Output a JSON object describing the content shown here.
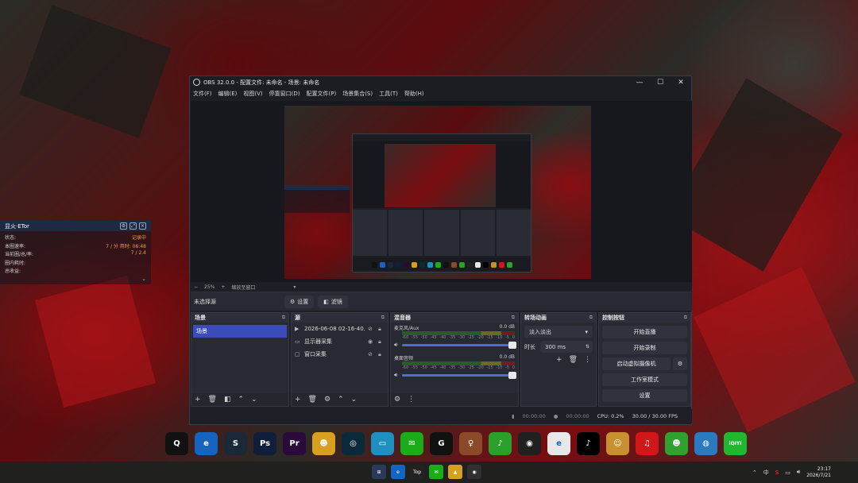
{
  "overlay": {
    "title": "显火·ETor",
    "rows": [
      {
        "label": "状态:",
        "value": "记录中"
      },
      {
        "label": "本圈速率:",
        "value": "7 / 分 用时: 06:48"
      },
      {
        "label": "当前圈/总/率:",
        "value": "7 / 2.4"
      },
      {
        "label": "圈内耗时:",
        "value": ""
      },
      {
        "label": "总收益:",
        "value": ""
      }
    ]
  },
  "obs": {
    "title": "OBS 32.0.0 - 配置文件: 未命名 - 场景: 未命名",
    "window_buttons": [
      "—",
      "☐",
      "✕"
    ],
    "menu": [
      "文件(F)",
      "编辑(E)",
      "视图(V)",
      "停靠窗口(D)",
      "配置文件(P)",
      "场景集合(S)",
      "工具(T)",
      "帮助(H)"
    ],
    "zoom": {
      "minus": "−",
      "value": "25%",
      "plus": "+",
      "mode": "缩放至窗口",
      "caret": "▾"
    },
    "source_bar": {
      "label": "未选择源",
      "settings": "设置",
      "filters": "滤镜"
    },
    "scenes": {
      "title": "场景",
      "items": [
        "场景"
      ]
    },
    "sources": {
      "title": "源",
      "items": [
        {
          "name": "2026-06-08 02-16-40.mkv",
          "icon": "▶"
        },
        {
          "name": "显示器采集",
          "icon": "▭"
        },
        {
          "name": "窗口采集",
          "icon": "▢"
        }
      ]
    },
    "mixer": {
      "title": "混音器",
      "channels": [
        {
          "name": "麦克风/Aux",
          "db": "0.0 dB"
        },
        {
          "name": "桌面音频",
          "db": "0.0 dB"
        }
      ],
      "ticks": [
        "-60",
        "-55",
        "-50",
        "-45",
        "-40",
        "-35",
        "-30",
        "-25",
        "-20",
        "-15",
        "-10",
        "-5",
        "0"
      ]
    },
    "transitions": {
      "title": "转场动画",
      "type": "淡入淡出",
      "duration_label": "时长",
      "duration": "300 ms"
    },
    "controls": {
      "title": "控制按钮",
      "buttons": [
        "开始直播",
        "开始录制",
        "启动虚拟摄像机",
        "工作室模式",
        "设置"
      ]
    },
    "status": {
      "stream_time": "00:00:00",
      "rec_time": "00:00:00",
      "cpu": "CPU: 0.2%",
      "fps": "30.00 / 30.00 FPS"
    }
  },
  "desktop_icons": [
    {
      "name": "QQ",
      "glyph": "Q",
      "color": "#111111"
    },
    {
      "name": "Edge",
      "glyph": "e",
      "color": "#1565c0"
    },
    {
      "name": "Steam",
      "glyph": "S",
      "color": "#1b2838"
    },
    {
      "name": "Photoshop",
      "glyph": "Ps",
      "color": "#0f1f3a"
    },
    {
      "name": "Premiere",
      "glyph": "Pr",
      "color": "#2a0a3a"
    },
    {
      "name": "App",
      "glyph": "☻",
      "color": "#d8a020"
    },
    {
      "name": "App2",
      "glyph": "◎",
      "color": "#0a2a3a"
    },
    {
      "name": "Monitor",
      "glyph": "▭",
      "color": "#1f8fc0"
    },
    {
      "name": "WeChat",
      "glyph": "✉",
      "color": "#1aad19"
    },
    {
      "name": "App3",
      "glyph": "G",
      "color": "#111111"
    },
    {
      "name": "Game",
      "glyph": "♀",
      "color": "#8a4a2a"
    },
    {
      "name": "App4",
      "glyph": "♪",
      "color": "#2aa02a"
    },
    {
      "name": "OBS",
      "glyph": "◉",
      "color": "#202020"
    },
    {
      "name": "Browser",
      "glyph": "e",
      "color": "#e8e8e8"
    },
    {
      "name": "TikTok",
      "glyph": "♪",
      "color": "#000000"
    },
    {
      "name": "App5",
      "glyph": "☺",
      "color": "#c89030"
    },
    {
      "name": "NetEase Music",
      "glyph": "♫",
      "color": "#d01818"
    },
    {
      "name": "App6",
      "glyph": "☻",
      "color": "#30a030"
    },
    {
      "name": "Globe",
      "glyph": "◍",
      "color": "#2a7ac0"
    },
    {
      "name": "iQIYI",
      "glyph": "iQIYI",
      "color": "#1fb830"
    }
  ],
  "taskbar": {
    "apps": [
      "⊞",
      "e",
      "Top",
      "✉",
      "▲",
      "◉"
    ],
    "tray": {
      "chevron": "⌃",
      "ime": "中",
      "time": "23:17",
      "date": "2026/7/21"
    }
  }
}
